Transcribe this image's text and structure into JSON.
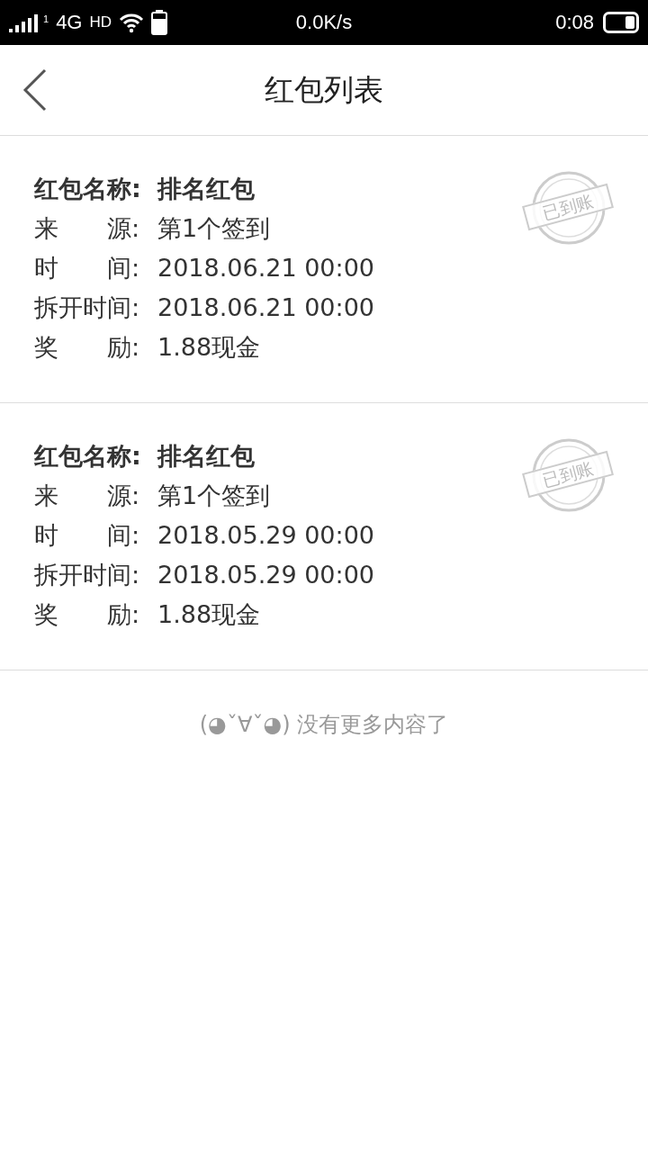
{
  "status_bar": {
    "sim_slot": "1",
    "network": "4G",
    "hd": "HD",
    "speed": "0.0K/s",
    "time": "0:08"
  },
  "header": {
    "title": "红包列表"
  },
  "records": [
    {
      "name_label": "红包名称:",
      "name": "排名红包",
      "stamp": "已到账",
      "fields": [
        {
          "label": "来　　源:",
          "value": "第1个签到"
        },
        {
          "label": "时　　间:",
          "value": "2018.06.21 00:00"
        },
        {
          "label": "拆开时间:",
          "value": "2018.06.21 00:00"
        },
        {
          "label": "奖　　励:",
          "value": "1.88现金"
        }
      ]
    },
    {
      "name_label": "红包名称:",
      "name": "排名红包",
      "stamp": "已到账",
      "fields": [
        {
          "label": "来　　源:",
          "value": "第1个签到"
        },
        {
          "label": "时　　间:",
          "value": "2018.05.29 00:00"
        },
        {
          "label": "拆开时间:",
          "value": "2018.05.29 00:00"
        },
        {
          "label": "奖　　励:",
          "value": "1.88现金"
        }
      ]
    }
  ],
  "footer": "(◕ˇ∀ˇ◕) 没有更多内容了"
}
